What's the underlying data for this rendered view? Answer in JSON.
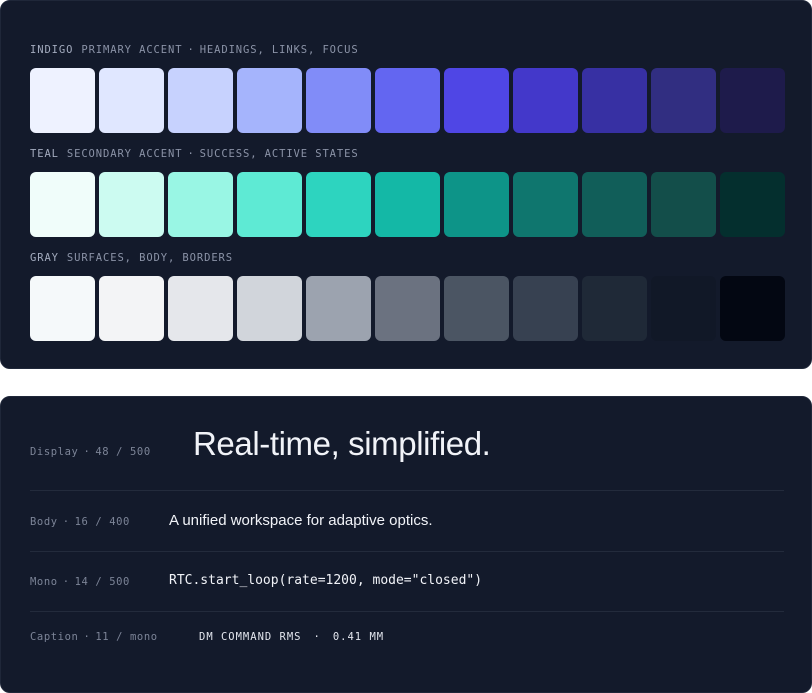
{
  "palettes": [
    {
      "name": "INDIGO",
      "role": "PRIMARY ACCENT",
      "usage": "HEADINGS, LINKS, FOCUS",
      "swatches": [
        "#eef2ff",
        "#e0e7ff",
        "#c7d2fe",
        "#a5b4fc",
        "#818cf8",
        "#6366f1",
        "#4f46e5",
        "#4338ca",
        "#3730a3",
        "#312e81",
        "#1e1b4b"
      ]
    },
    {
      "name": "TEAL",
      "role": "SECONDARY ACCENT",
      "usage": "SUCCESS, ACTIVE STATES",
      "swatches": [
        "#f0fdfa",
        "#ccfbf1",
        "#99f6e4",
        "#5eead4",
        "#2dd4bf",
        "#14b8a6",
        "#0d9488",
        "#0f766e",
        "#115e59",
        "#134e4a",
        "#042f2e"
      ]
    },
    {
      "name": "GRAY",
      "role": "",
      "usage": "SURFACES, BODY, BORDERS",
      "swatches": [
        "#f5f9fa",
        "#f3f4f6",
        "#e5e7eb",
        "#d1d5db",
        "#9ca3af",
        "#6b7280",
        "#4b5563",
        "#374151",
        "#1f2937",
        "#111827",
        "#030712"
      ]
    }
  ],
  "type_specs": [
    {
      "style": "Display",
      "size": "48",
      "weight": "500",
      "sample": "Real-time, simplified."
    },
    {
      "style": "Body",
      "size": "16",
      "weight": "400",
      "sample": "A unified workspace for adaptive optics."
    },
    {
      "style": "Mono",
      "size": "14",
      "weight": "500",
      "sample": "RTC.start_loop(rate=1200, mode=\"closed\")"
    },
    {
      "style": "Caption",
      "size": "11",
      "weight": "mono",
      "sample": "DM COMMAND RMS",
      "value": "0.41 MM"
    }
  ],
  "separators": {
    "dot": "·",
    "slash": "/"
  }
}
